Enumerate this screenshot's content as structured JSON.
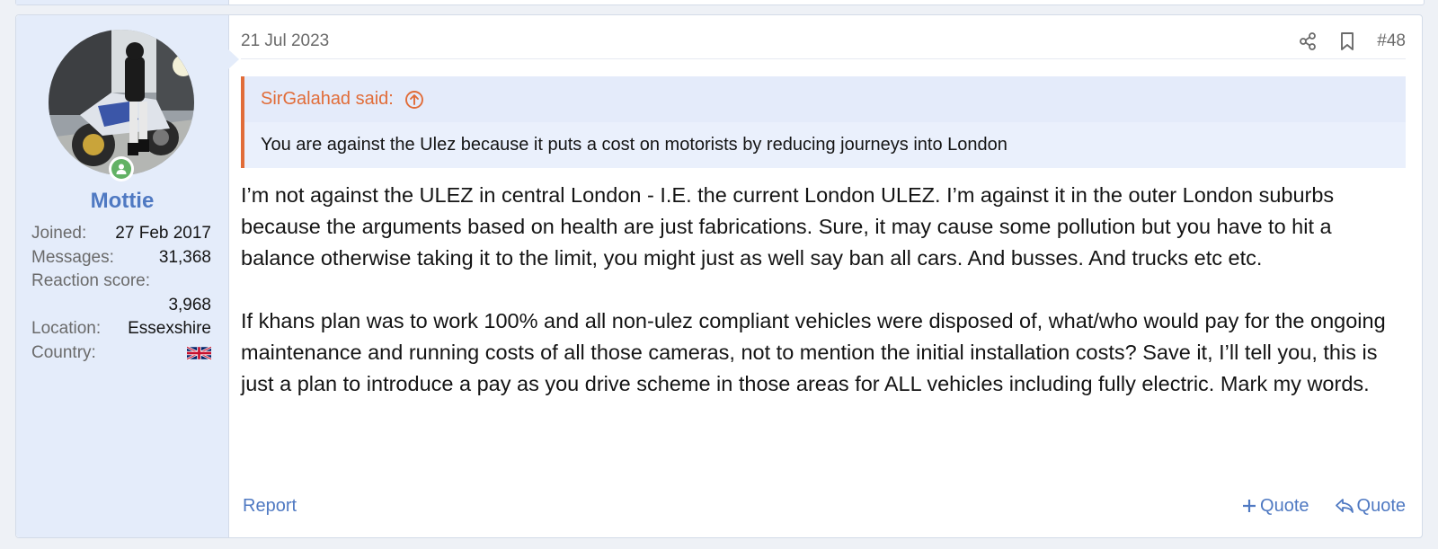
{
  "post": {
    "date": "21 Jul 2023",
    "number": "#48",
    "icons": {
      "share": "share-icon",
      "bookmark": "bookmark-icon"
    }
  },
  "user": {
    "name": "Mottie",
    "online": true,
    "stats": [
      {
        "label": "Joined:",
        "value": "27 Feb 2017"
      },
      {
        "label": "Messages:",
        "value": "31,368"
      },
      {
        "label": "Reaction score:",
        "value": "3,968"
      },
      {
        "label": "Location:",
        "value": "Essexshire"
      },
      {
        "label": "Country:",
        "value": ""
      }
    ],
    "country_flag": "uk-flag-icon"
  },
  "quote": {
    "author_line": "SirGalahad said:",
    "text": "You are against the Ulez because it puts a cost on motorists by reducing journeys into London"
  },
  "message": {
    "paragraphs": [
      "I’m not against the ULEZ in central London - I.E. the current London ULEZ. I’m against it in the outer London suburbs because the arguments based on health are just fabrications. Sure, it may cause some pollution but you have to hit a balance otherwise taking it to the limit, you might just as well say ban all cars. And busses. And trucks etc etc.",
      "If khans plan was to work 100% and all non-ulez compliant vehicles were disposed of, what/who would pay for the ongoing maintenance and running costs of all those cameras, not to mention the initial installation costs? Save it, I’ll tell you, this is just a plan to introduce a pay as you drive scheme in those areas for ALL vehicles including fully electric. Mark my words."
    ]
  },
  "footer": {
    "report": "Report",
    "multiquote": "Quote",
    "reply_quote": "Quote"
  },
  "colors": {
    "accent": "#4f79c2",
    "quote_accent": "#e16c38",
    "sidebar_bg": "#e4ecfa",
    "online": "#63b265"
  }
}
